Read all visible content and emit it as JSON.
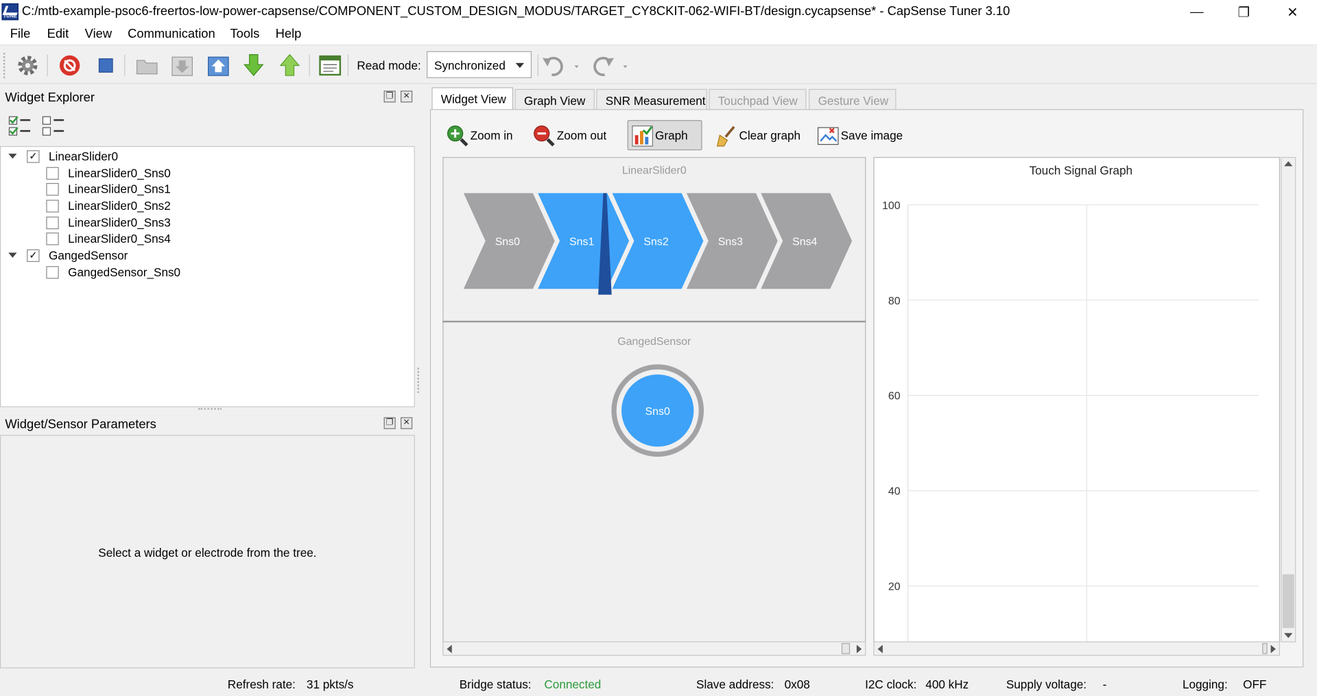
{
  "window": {
    "title": "C:/mtb-example-psoc6-freertos-low-power-capsense/COMPONENT_CUSTOM_DESIGN_MODUS/TARGET_CY8CKIT-062-WIFI-BT/design.cycapsense* - CapSense Tuner 3.10",
    "icon_text": "TUNE",
    "minimize": "—",
    "restore": "❐",
    "close": "✕"
  },
  "menu": [
    "File",
    "Edit",
    "View",
    "Communication",
    "Tools",
    "Help"
  ],
  "toolbar": {
    "read_mode_label": "Read mode:",
    "read_mode_value": "Synchronized"
  },
  "widget_explorer": {
    "title": "Widget Explorer",
    "tree": [
      {
        "label": "LinearSlider0",
        "checked": true,
        "expanded": true,
        "children": [
          {
            "label": "LinearSlider0_Sns0",
            "checked": false
          },
          {
            "label": "LinearSlider0_Sns1",
            "checked": false
          },
          {
            "label": "LinearSlider0_Sns2",
            "checked": false
          },
          {
            "label": "LinearSlider0_Sns3",
            "checked": false
          },
          {
            "label": "LinearSlider0_Sns4",
            "checked": false
          }
        ]
      },
      {
        "label": "GangedSensor",
        "checked": true,
        "expanded": true,
        "children": [
          {
            "label": "GangedSensor_Sns0",
            "checked": false
          }
        ]
      }
    ]
  },
  "params_panel": {
    "title": "Widget/Sensor Parameters",
    "message": "Select a widget or electrode from the tree."
  },
  "tabs": [
    {
      "label": "Widget View",
      "active": true,
      "enabled": true
    },
    {
      "label": "Graph View",
      "active": false,
      "enabled": true
    },
    {
      "label": "SNR Measurement",
      "active": false,
      "enabled": true
    },
    {
      "label": "Touchpad View",
      "active": false,
      "enabled": false
    },
    {
      "label": "Gesture View",
      "active": false,
      "enabled": false
    }
  ],
  "actions": {
    "zoom_in": "Zoom in",
    "zoom_out": "Zoom out",
    "graph": "Graph",
    "clear_graph": "Clear graph",
    "save_image": "Save image"
  },
  "widgets": {
    "slider": {
      "name": "LinearSlider0",
      "segments": [
        {
          "label": "Sns0",
          "active": false
        },
        {
          "label": "Sns1",
          "active": true
        },
        {
          "label": "Sns2",
          "active": true
        },
        {
          "label": "Sns3",
          "active": false
        },
        {
          "label": "Sns4",
          "active": false
        }
      ],
      "position_percent": 37
    },
    "ganged": {
      "name": "GangedSensor",
      "sensor_label": "Sns0",
      "active": true
    }
  },
  "colors": {
    "active": "#3da2f8",
    "inactive": "#a3a3a6",
    "position_marker": "#1f4e9c",
    "connected": "#2a9a3a"
  },
  "chart_data": {
    "type": "line",
    "title": "Touch Signal Graph",
    "xlabel": "",
    "ylabel": "",
    "y_ticks": [
      100,
      80,
      60,
      40,
      20
    ],
    "ylim": [
      8,
      100
    ],
    "grid": true,
    "series": []
  },
  "status": {
    "refresh_label": "Refresh rate:",
    "refresh_value": "31 pkts/s",
    "bridge_label": "Bridge status:",
    "bridge_value": "Connected",
    "slave_label": "Slave address:",
    "slave_value": "0x08",
    "i2c_label": "I2C clock:",
    "i2c_value": "400 kHz",
    "supply_label": "Supply voltage:",
    "supply_value": "-",
    "logging_label": "Logging:",
    "logging_value": "OFF"
  }
}
